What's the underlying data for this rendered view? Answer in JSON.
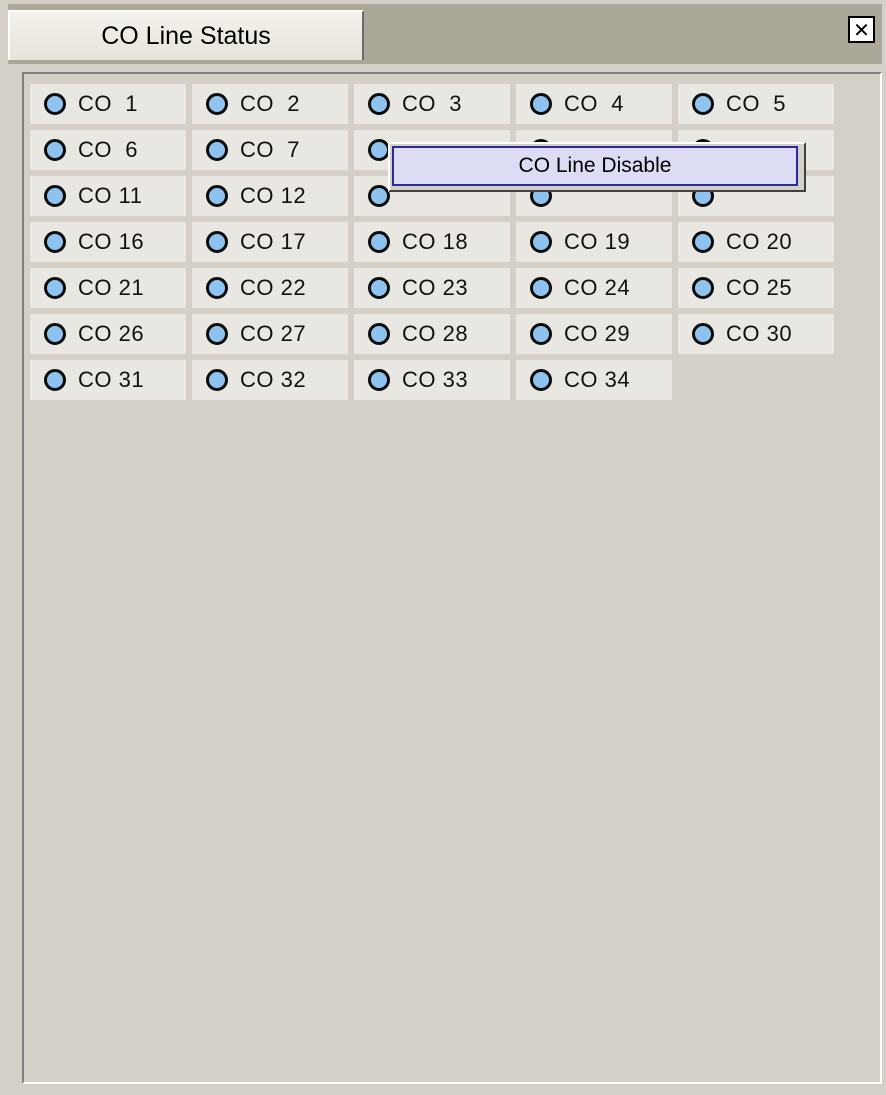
{
  "window": {
    "tab_title": "CO Line Status",
    "close_symbol": "✕"
  },
  "co_lines": [
    "CO  1",
    "CO  2",
    "CO  3",
    "CO  4",
    "CO  5",
    "CO  6",
    "CO  7",
    "",
    "",
    "",
    "CO 11",
    "CO 12",
    "",
    "",
    "",
    "CO 16",
    "CO 17",
    "CO 18",
    "CO 19",
    "CO 20",
    "CO 21",
    "CO 22",
    "CO 23",
    "CO 24",
    "CO 25",
    "CO 26",
    "CO 27",
    "CO 28",
    "CO 29",
    "CO 30",
    "CO 31",
    "CO 32",
    "CO 33",
    "CO 34"
  ],
  "context_menu": {
    "items": [
      "CO Line Disable"
    ]
  },
  "colors": {
    "led_fill": "#8fc3ef",
    "menu_highlight": "#dcdcf4",
    "menu_border": "#2a2a9a"
  }
}
